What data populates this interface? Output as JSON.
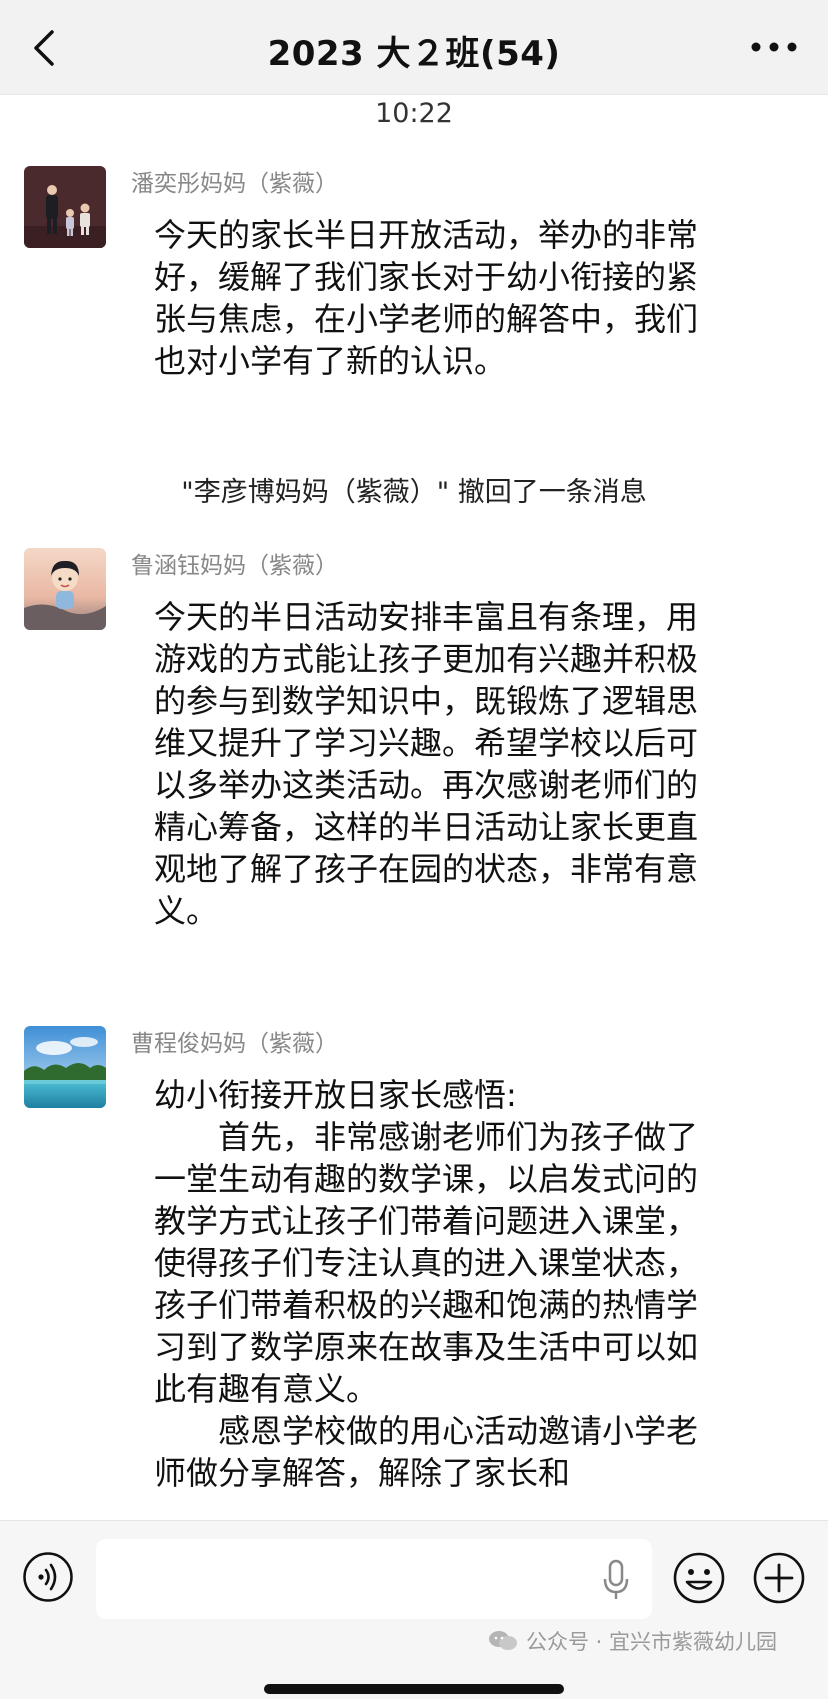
{
  "header": {
    "title": "2023  大２班(54)",
    "back_icon": "chevron-left-icon",
    "more_icon": "ellipsis-icon"
  },
  "timestamp": "10:22",
  "messages": [
    {
      "sender": "潘奕彤妈妈（紫薇）",
      "avatar": "family-photo-avatar",
      "text": "今天的家长半日开放活动，举办的非常好，缓解了我们家长对于幼小衔接的紧张与焦虑，在小学老师的解答中，我们也对小学有了新的认识。"
    },
    {
      "sender": "鲁涵钰妈妈（紫薇）",
      "avatar": "cartoon-girl-avatar",
      "text": "今天的半日活动安排丰富且有条理，用游戏的方式能让孩子更加有兴趣并积极的参与到数学知识中，既锻炼了逻辑思维又提升了学习兴趣。希望学校以后可以多举办这类活动。再次感谢老师们的精心筹备，这样的半日活动让家长更直观地了解了孩子在园的状态，非常有意义。"
    },
    {
      "sender": "曹程俊妈妈（紫薇）",
      "avatar": "landscape-avatar",
      "text": "幼小衔接开放日家长感悟:\n　　首先，非常感谢老师们为孩子做了一堂生动有趣的数学课，以启发式问的教学方式让孩子们带着问题进入课堂，使得孩子们专注认真的进入课堂状态，孩子们带着积极的兴趣和饱满的热情学习到了数学原来在故事及生活中可以如此有趣有意义。\n　　感恩学校做的用心活动邀请小学老师做分享解答，解除了家长和"
    }
  ],
  "system_note": "\"李彦博妈妈（紫薇）\" 撤回了一条消息",
  "input_bar": {
    "placeholder": "",
    "voice_icon": "voice-mode-icon",
    "mic_icon": "microphone-icon",
    "emoji_icon": "emoji-icon",
    "plus_icon": "plus-circle-icon"
  },
  "watermark": "公众号 · 宜兴市紫薇幼儿园"
}
